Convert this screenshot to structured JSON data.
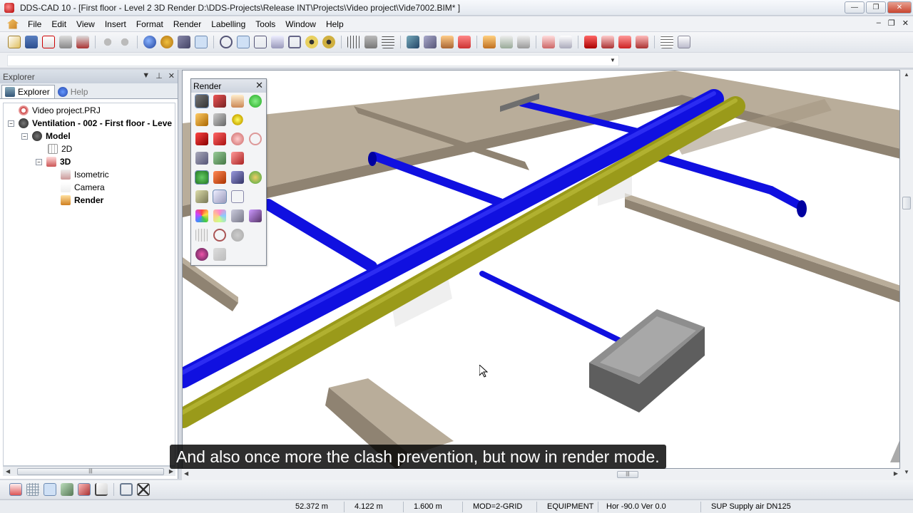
{
  "window": {
    "title": "DDS-CAD 10 - [First floor - Level 2  3D  Render  D:\\DDS-Projects\\Release INT\\Projects\\Video project\\Vide7002.BIM* ]",
    "minimize": "—",
    "maximize": "❐",
    "close": "✕"
  },
  "menu": {
    "items": [
      "File",
      "Edit",
      "View",
      "Insert",
      "Format",
      "Render",
      "Labelling",
      "Tools",
      "Window",
      "Help"
    ],
    "mdi_minimize": "–",
    "mdi_restore": "❐",
    "mdi_close": "✕"
  },
  "command_line": {
    "value": ""
  },
  "explorer": {
    "title": "Explorer",
    "header_buttons": [
      "▼",
      "⊥",
      "✕"
    ],
    "tabs": [
      "Explorer",
      "Help"
    ],
    "tree": [
      {
        "label": "Video project.PRJ",
        "bold": false,
        "expander": ""
      },
      {
        "label": "Ventilation - 002 - First floor - Leve",
        "bold": true,
        "expander": "−"
      },
      {
        "label": "Model",
        "bold": true,
        "expander": "−"
      },
      {
        "label": "2D",
        "bold": false,
        "expander": ""
      },
      {
        "label": "3D",
        "bold": true,
        "expander": "−"
      },
      {
        "label": "Isometric",
        "bold": false,
        "expander": ""
      },
      {
        "label": "Camera",
        "bold": false,
        "expander": ""
      },
      {
        "label": "Render",
        "bold": true,
        "expander": ""
      }
    ],
    "scroll_grip": "|||"
  },
  "render_panel": {
    "title": "Render",
    "close": "✕"
  },
  "viewport": {
    "hscroll_grip": "|||",
    "colors": {
      "beam": "#b9ad9a",
      "beam_dark": "#8f8372",
      "duct_blue": "#1010e0",
      "duct_blue_dark": "#0000a0",
      "duct_yellow": "#9a9a1a",
      "duct_yellow_dark": "#6d6d0c",
      "equipment": "#8e8e8e",
      "equipment_dark": "#5e5e5e"
    }
  },
  "subtitle": "And also once more the clash prevention, but now in render mode.",
  "status": {
    "x": "52.372 m",
    "y": "4.122 m",
    "z": "1.600 m",
    "mode": "MOD=2-GRID",
    "layer": "EQUIPMENT",
    "view": "Hor -90.0 Ver  0.0",
    "system": "SUP Supply air DN125"
  }
}
